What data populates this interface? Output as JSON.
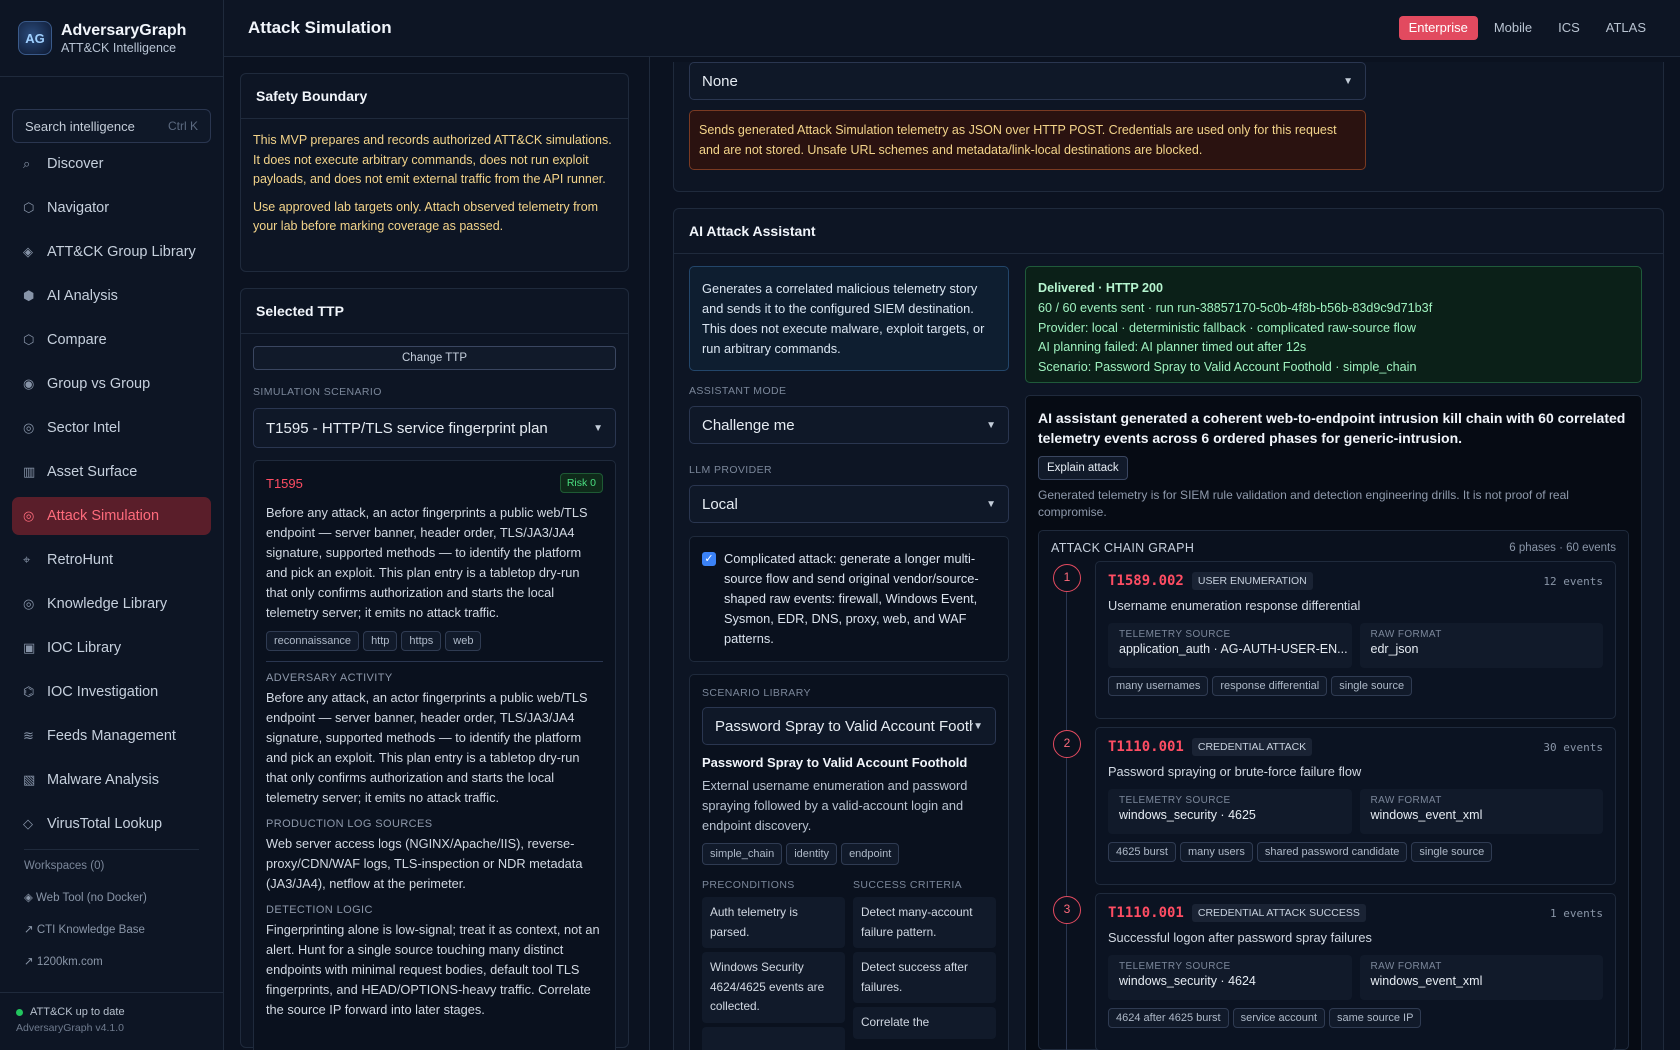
{
  "brand": {
    "title": "AdversaryGraph",
    "subtitle": "ATT&CK Intelligence",
    "logo_text": "AG"
  },
  "search": {
    "placeholder": "Search intelligence",
    "shortcut": "Ctrl K"
  },
  "nav": [
    {
      "icon": "⌕",
      "label": "Discover",
      "name": "discover",
      "active": false
    },
    {
      "icon": "⬡",
      "label": "Navigator",
      "name": "navigator",
      "active": false
    },
    {
      "icon": "◈",
      "label": "ATT&CK Group Library",
      "name": "group-library",
      "active": false
    },
    {
      "icon": "⬢",
      "label": "AI Analysis",
      "name": "ai-analysis",
      "active": false
    },
    {
      "icon": "⬡",
      "label": "Compare",
      "name": "compare",
      "active": false
    },
    {
      "icon": "◉",
      "label": "Group vs Group",
      "name": "group-vs-group",
      "active": false
    },
    {
      "icon": "◎",
      "label": "Sector Intel",
      "name": "sector-intel",
      "active": false
    },
    {
      "icon": "▥",
      "label": "Asset Surface",
      "name": "asset-surface",
      "active": false
    },
    {
      "icon": "◎",
      "label": "Attack Simulation",
      "name": "attack-simulation",
      "active": true
    },
    {
      "icon": "⌖",
      "label": "RetroHunt",
      "name": "retrohunt",
      "active": false
    },
    {
      "icon": "◎",
      "label": "Knowledge Library",
      "name": "knowledge-library",
      "active": false
    },
    {
      "icon": "▣",
      "label": "IOC Library",
      "name": "ioc-library",
      "active": false
    },
    {
      "icon": "⌬",
      "label": "IOC Investigation",
      "name": "ioc-investigation",
      "active": false
    },
    {
      "icon": "≋",
      "label": "Feeds Management",
      "name": "feeds-management",
      "active": false
    },
    {
      "icon": "▧",
      "label": "Malware Analysis",
      "name": "malware-analysis",
      "active": false
    },
    {
      "icon": "◇",
      "label": "VirusTotal Lookup",
      "name": "virustotal-lookup",
      "active": false
    }
  ],
  "workspaces": {
    "title": "Workspaces (0)",
    "links": [
      "◈ Web Tool (no Docker)",
      "↗ CTI Knowledge Base",
      "↗ 1200km.com"
    ]
  },
  "footer": {
    "status": "ATT&CK up to date",
    "version": "AdversaryGraph v4.1.0"
  },
  "header": {
    "title": "Attack Simulation",
    "tabs": [
      "Enterprise",
      "Mobile",
      "ICS",
      "ATLAS"
    ],
    "active_tab": "Enterprise"
  },
  "safety": {
    "title": "Safety Boundary",
    "p1": "This MVP prepares and records authorized ATT&CK simulations. It does not execute arbitrary commands, does not run exploit payloads, and does not emit external traffic from the API runner.",
    "p2": "Use approved lab targets only. Attach observed telemetry from your lab before marking coverage as passed."
  },
  "ttp": {
    "title": "Selected TTP",
    "change_btn": "Change TTP",
    "scenario_label": "SIMULATION SCENARIO",
    "scenario_value": "T1595 - HTTP/TLS service fingerprint plan",
    "id": "T1595",
    "risk": "Risk 0",
    "desc": "Before any attack, an actor fingerprints a public web/TLS endpoint — server banner, header order, TLS/JA3/JA4 signature, supported methods — to identify the platform and pick an exploit. This plan entry is a tabletop dry-run that only confirms authorization and starts the local telemetry server; it emits no attack traffic.",
    "tags": [
      "reconnaissance",
      "http",
      "https",
      "web"
    ],
    "adv_label": "ADVERSARY ACTIVITY",
    "adv_text": "Before any attack, an actor fingerprints a public web/TLS endpoint — server banner, header order, TLS/JA3/JA4 signature, supported methods — to identify the platform and pick an exploit. This plan entry is a tabletop dry-run that only confirms authorization and starts the local telemetry server; it emits no attack traffic.",
    "log_label": "PRODUCTION LOG SOURCES",
    "log_text": "Web server access logs (NGINX/Apache/IIS), reverse-proxy/CDN/WAF logs, TLS-inspection or NDR metadata (JA3/JA4), netflow at the perimeter.",
    "det_label": "DETECTION LOGIC",
    "det_text": "Fingerprinting alone is low-signal; treat it as context, not an alert. Hunt for a single source touching many distinct endpoints with minimal request bodies, default tool TLS fingerprints, and HEAD/OPTIONS-heavy traffic. Correlate the source IP forward into later stages."
  },
  "siem": {
    "auth_value": "None",
    "note": "Sends generated Attack Simulation telemetry as JSON over HTTP POST. Credentials are used only for this request and are not stored. Unsafe URL schemes and metadata/link-local destinations are blocked."
  },
  "assistant": {
    "title": "AI Attack Assistant",
    "info": "Generates a correlated malicious telemetry story and sends it to the configured SIEM destination. This does not execute malware, exploit targets, or run arbitrary commands.",
    "mode_label": "ASSISTANT MODE",
    "mode_value": "Challenge me",
    "llm_label": "LLM PROVIDER",
    "llm_value": "Local",
    "complicated_text": "Complicated attack: generate a longer multi-source flow and send original vendor/source-shaped raw events: firewall, Windows Event, Sysmon, EDR, DNS, proxy, web, and WAF patterns.",
    "lib_label": "SCENARIO LIBRARY",
    "lib_value": "Password Spray to Valid Account Foothold",
    "lib_title": "Password Spray to Valid Account Foothold",
    "lib_desc": "External username enumeration and password spraying followed by a valid-account login and endpoint discovery.",
    "lib_tags": [
      "simple_chain",
      "identity",
      "endpoint"
    ],
    "pre_label": "PRECONDITIONS",
    "pre_items": [
      "Auth telemetry is parsed.",
      "Windows Security 4624/4625 events are collected.",
      ""
    ],
    "succ_label": "SUCCESS CRITERIA",
    "succ_items": [
      "Detect many-account failure pattern.",
      "Detect success after failures.",
      "Correlate the"
    ]
  },
  "delivery": {
    "title": "Delivered · HTTP 200",
    "l1": "60 / 60 events sent · run run-38857170-5c0b-4f8b-b56b-83d9c9d71b3f",
    "l2": "Provider: local · deterministic fallback · complicated raw-source flow",
    "l3": "AI planning failed: AI planner timed out after 12s",
    "l4": "Scenario: Password Spray to Valid Account Foothold · simple_chain"
  },
  "summary": {
    "headline": "AI assistant generated a coherent web-to-endpoint intrusion kill chain with 60 correlated telemetry events across 6 ordered phases for generic-intrusion.",
    "explain_btn": "Explain attack",
    "note": "Generated telemetry is for SIEM rule validation and detection engineering drills. It is not proof of real compromise."
  },
  "graph": {
    "title": "ATTACK CHAIN GRAPH",
    "meta": "6 phases · 60 events",
    "src_label": "TELEMETRY SOURCE",
    "fmt_label": "RAW FORMAT",
    "phases": [
      {
        "n": "1",
        "id": "T1589.002",
        "type": "USER ENUMERATION",
        "events": "12 events",
        "title": "Username enumeration response differential",
        "source": "application_auth · AG-AUTH-USER-EN...",
        "format": "edr_json",
        "tags": [
          "many usernames",
          "response differential",
          "single source"
        ]
      },
      {
        "n": "2",
        "id": "T1110.001",
        "type": "CREDENTIAL ATTACK",
        "events": "30 events",
        "title": "Password spraying or brute-force failure flow",
        "source": "windows_security · 4625",
        "format": "windows_event_xml",
        "tags": [
          "4625 burst",
          "many users",
          "shared password candidate",
          "single source"
        ]
      },
      {
        "n": "3",
        "id": "T1110.001",
        "type": "CREDENTIAL ATTACK SUCCESS",
        "events": "1 events",
        "title": "Successful logon after password spray failures",
        "source": "windows_security · 4624",
        "format": "windows_event_xml",
        "tags": [
          "4624 after 4625 burst",
          "service account",
          "same source IP"
        ]
      }
    ]
  },
  "colors": {
    "accent": "#e24a5f",
    "ok": "#22c55e",
    "warn": "#f3d48a",
    "id_red": "#ff4d63"
  }
}
